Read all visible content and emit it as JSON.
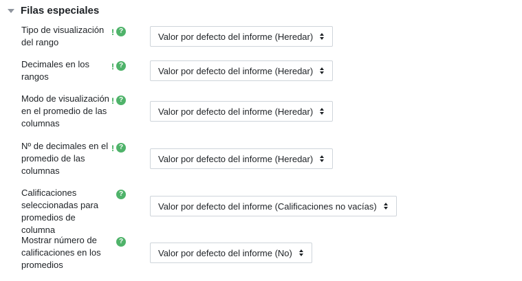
{
  "section": {
    "title": "Filas especiales",
    "required_mark": "!",
    "help_glyph": "?",
    "accent_color": "#4fb36a",
    "rows": [
      {
        "label": "Tipo de visualización del rango",
        "required": true,
        "selected": "Valor por defecto del informe (Heredar)"
      },
      {
        "label": "Decimales en los rangos",
        "required": true,
        "selected": "Valor por defecto del informe (Heredar)"
      },
      {
        "label": "Modo de visualización en el promedio de las columnas",
        "required": true,
        "selected": "Valor por defecto del informe (Heredar)"
      },
      {
        "label": "Nº de decimales en el promedio de las columnas",
        "required": true,
        "selected": "Valor por defecto del informe (Heredar)"
      },
      {
        "label": "Calificaciones seleccionadas para promedios de columna",
        "required": false,
        "selected": "Valor por defecto del informe (Calificaciones no vacías)"
      },
      {
        "label": "Mostrar número de calificaciones en los promedios",
        "required": false,
        "selected": "Valor por defecto del informe (No)"
      }
    ]
  }
}
